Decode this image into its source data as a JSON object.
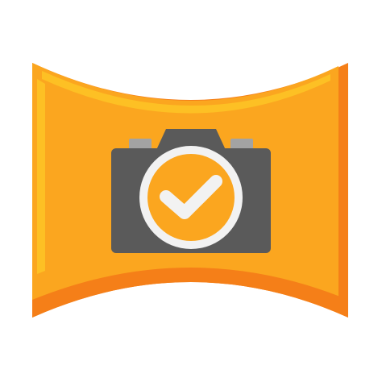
{
  "icon": {
    "name": "panorama-camera-check-icon",
    "parts": [
      "panorama-frame",
      "camera-body",
      "camera-lens",
      "checkmark"
    ]
  },
  "colors": {
    "background": "#ffffff",
    "frame_fill": "#fba61f",
    "frame_highlight": "#fdc024",
    "frame_shadow": "#f57f18",
    "camera_body": "#5a5a5a",
    "camera_button": "#a3a3a3",
    "lens_ring": "#f2f2f2",
    "lens_fill": "#fba61f",
    "check": "#f2f2f2"
  }
}
